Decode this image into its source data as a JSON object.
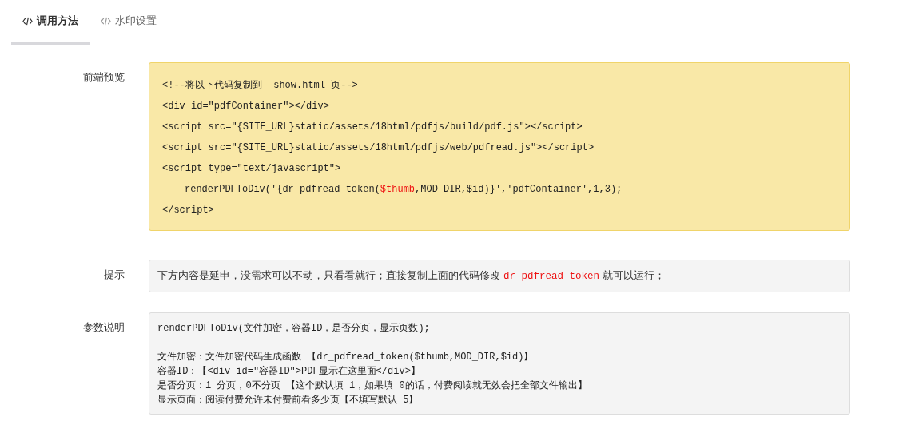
{
  "tabs": [
    {
      "label": "调用方法",
      "selected": true
    },
    {
      "label": "水印设置",
      "selected": false
    }
  ],
  "preview": {
    "label": "前端预览",
    "lines": [
      {
        "indent": false,
        "parts": [
          {
            "text": "<!--将以下代码复制到  show.html 页-->",
            "highlight": false
          }
        ]
      },
      {
        "indent": false,
        "parts": [
          {
            "text": "<div id=\"pdfContainer\"></div>",
            "highlight": false
          }
        ]
      },
      {
        "indent": false,
        "parts": [
          {
            "text": "<script src=\"{SITE_URL}static/assets/18html/pdfjs/build/pdf.js\"></script>",
            "highlight": false
          }
        ]
      },
      {
        "indent": false,
        "parts": [
          {
            "text": "<script src=\"{SITE_URL}static/assets/18html/pdfjs/web/pdfread.js\"></script>",
            "highlight": false
          }
        ]
      },
      {
        "indent": false,
        "parts": [
          {
            "text": "<script type=\"text/javascript\">",
            "highlight": false
          }
        ]
      },
      {
        "indent": true,
        "parts": [
          {
            "text": "renderPDFToDiv('{dr_pdfread_token(",
            "highlight": false
          },
          {
            "text": "$thumb",
            "highlight": true
          },
          {
            "text": ",MOD_DIR,$id)}','pdfContainer',1,3);",
            "highlight": false
          }
        ]
      },
      {
        "indent": false,
        "parts": [
          {
            "text": "</script>",
            "highlight": false
          }
        ]
      }
    ]
  },
  "tip": {
    "label": "提示",
    "parts": [
      {
        "text": "下方内容是延申，没需求可以不动，只看看就行；直接复制上面的代码修改 ",
        "highlight": false
      },
      {
        "text": "dr_pdfread_token",
        "highlight": true
      },
      {
        "text": " 就可以运行；",
        "highlight": false
      }
    ]
  },
  "params": {
    "label": "参数说明",
    "signature": "renderPDFToDiv(文件加密，容器ID，是否分页，显示页数);",
    "items": [
      "文件加密：文件加密代码生成函数 【dr_pdfread_token($thumb,MOD_DIR,$id)】",
      "容器ID：【<div id=\"容器ID\">PDF显示在这里面</div>】",
      "是否分页：1 分页，0不分页 【这个默认填 1，如果填 0的话，付费阅读就无效会把全部文件输出】",
      "显示页面：阅读付费允许未付费前看多少页【不填写默认 5】"
    ]
  }
}
